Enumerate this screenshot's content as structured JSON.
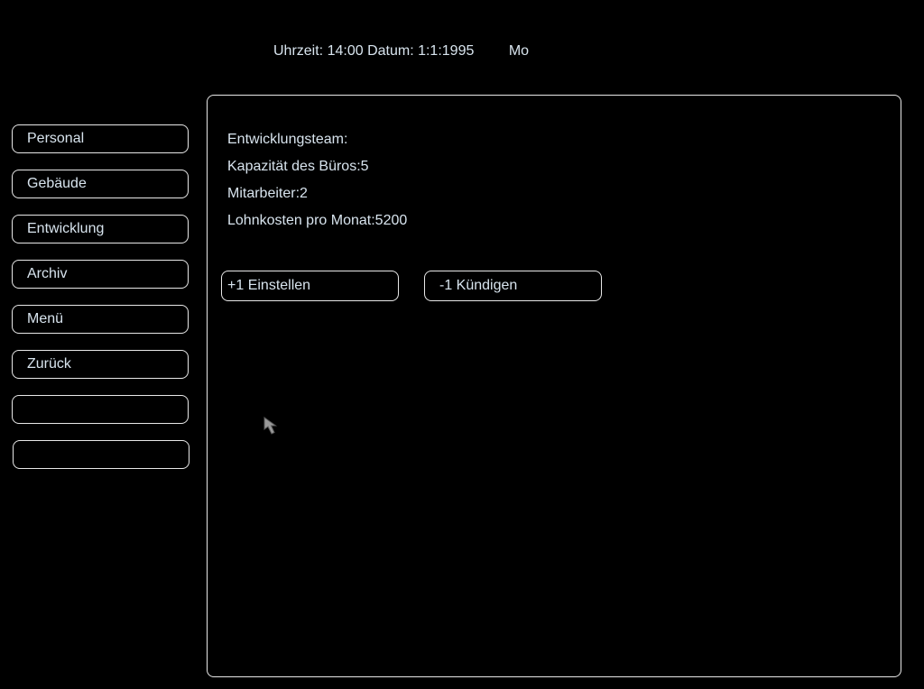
{
  "status": {
    "time": "Uhrzeit: 14:00",
    "date": "Datum: 1:1:1995",
    "weekday": "Mo"
  },
  "menu": {
    "items": [
      {
        "label": "Personal"
      },
      {
        "label": "Gebäude"
      },
      {
        "label": "Entwicklung"
      },
      {
        "label": "Archiv"
      },
      {
        "label": "Menü"
      },
      {
        "label": "Zurück"
      },
      {
        "label": ""
      },
      {
        "label": ""
      }
    ]
  },
  "team": {
    "heading": "Entwicklungsteam:",
    "capacity": "Kapazität des Büros:5",
    "employees": "Mitarbeiter:2",
    "wage_costs": "Lohnkosten pro Monat:5200"
  },
  "actions": {
    "hire_label": "+1 Einstellen",
    "fire_label": "-1 Kündigen"
  },
  "icons": {
    "cursor": "mouse-pointer-icon"
  },
  "colors": {
    "background": "#000000",
    "text": "#d8e4ee",
    "border": "#e8e8e8"
  }
}
